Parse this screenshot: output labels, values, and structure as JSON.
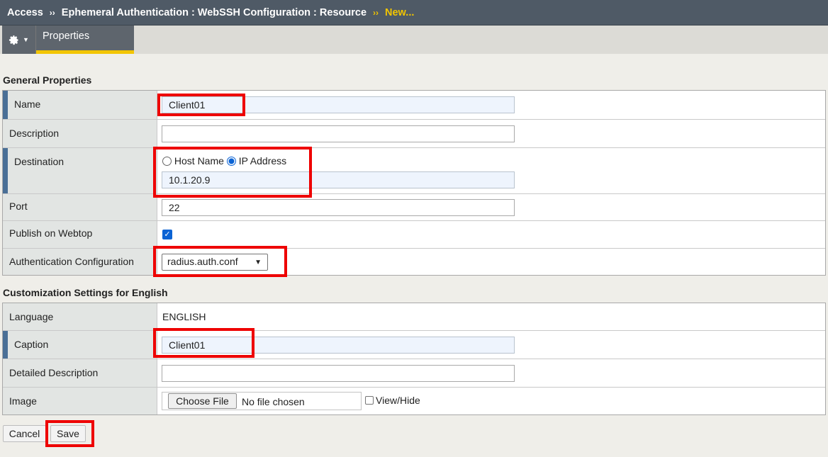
{
  "breadcrumb": {
    "items": [
      "Access",
      "Ephemeral Authentication : WebSSH Configuration : Resource"
    ],
    "separator": "››",
    "current": "New..."
  },
  "tabs": {
    "settings_icon": "gear-icon",
    "properties": "Properties"
  },
  "general": {
    "title": "General Properties",
    "name_label": "Name",
    "name_value": "Client01",
    "description_label": "Description",
    "description_value": "",
    "destination_label": "Destination",
    "host_name_option": "Host Name",
    "ip_address_option": "IP Address",
    "destination_selected": "IP Address",
    "ip_value": "10.1.20.9",
    "port_label": "Port",
    "port_value": "22",
    "publish_label": "Publish on Webtop",
    "publish_checked": true,
    "auth_label": "Authentication Configuration",
    "auth_value": "radius.auth.conf"
  },
  "customization": {
    "title": "Customization Settings for English",
    "language_label": "Language",
    "language_value": "ENGLISH",
    "caption_label": "Caption",
    "caption_value": "Client01",
    "detailed_label": "Detailed Description",
    "detailed_value": "",
    "image_label": "Image",
    "choose_file": "Choose File",
    "no_file": "No file chosen",
    "view_hide": "View/Hide"
  },
  "actions": {
    "cancel": "Cancel",
    "save": "Save"
  },
  "colors": {
    "highlight": "#ee0000",
    "accent": "#f2c500",
    "required_marker": "#4a6f96"
  }
}
